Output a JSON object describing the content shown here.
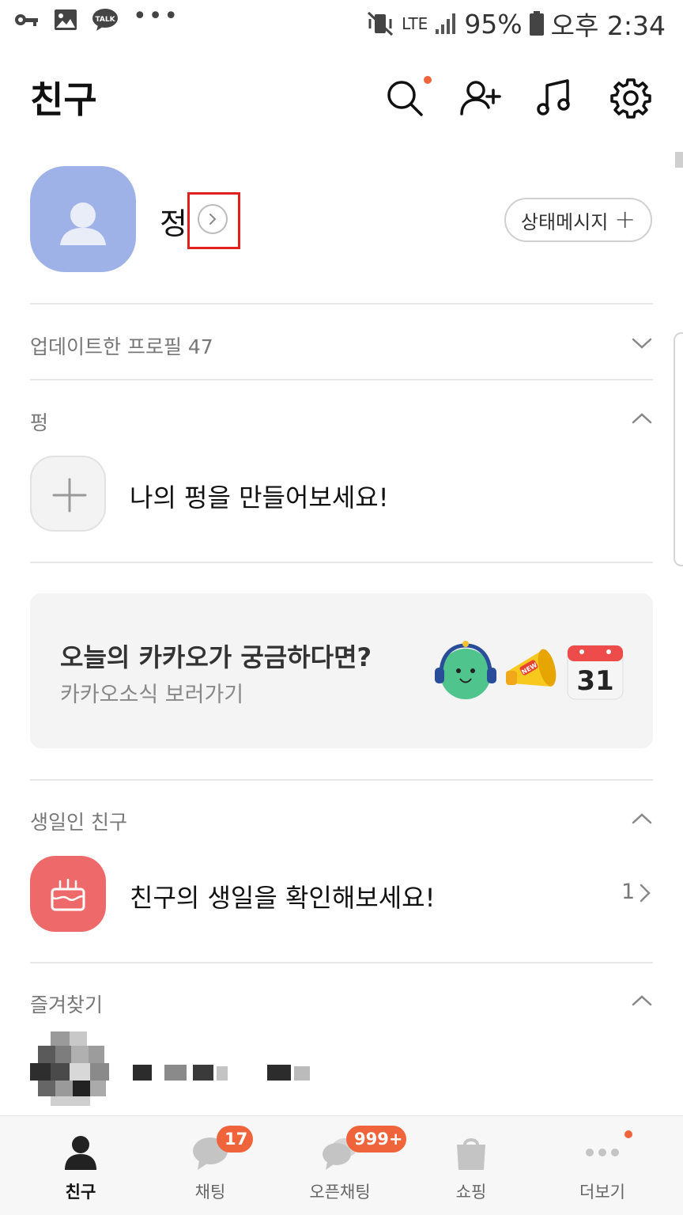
{
  "status_bar": {
    "battery": "95%",
    "time": "오후 2:34",
    "network": "LTE",
    "notification_icons": [
      "key-icon",
      "image-icon",
      "talk-icon"
    ],
    "more": "•••"
  },
  "header": {
    "title": "친구",
    "icons": [
      "search-icon",
      "add-friend-icon",
      "music-icon",
      "settings-icon"
    ]
  },
  "profile": {
    "name": "정",
    "status_message_button": "상태메시지"
  },
  "sections": {
    "updated_profiles": "업데이트한 프로필 47",
    "pyeong": {
      "label": "펑",
      "cta": "나의 펑을 만들어보세요!"
    },
    "banner": {
      "title": "오늘의 카카오가 궁금하다면?",
      "subtitle": "카카오소식 보러가기",
      "calendar_day": "31",
      "new_tag": "NEW"
    },
    "birthday": {
      "label": "생일인 친구",
      "cta": "친구의 생일을 확인해보세요!",
      "count": "1"
    },
    "favorites": {
      "label": "즐겨찾기"
    }
  },
  "tabbar": {
    "tabs": [
      {
        "label": "친구",
        "active": true
      },
      {
        "label": "채팅",
        "badge": "17"
      },
      {
        "label": "오픈채팅",
        "badge": "999+"
      },
      {
        "label": "쇼핑"
      },
      {
        "label": "더보기"
      }
    ]
  },
  "colors": {
    "accent": "#f0643c",
    "avatar_bg": "#9fb2e8",
    "birthday_bg": "#ee6a6a",
    "highlight": "#e0211d"
  }
}
